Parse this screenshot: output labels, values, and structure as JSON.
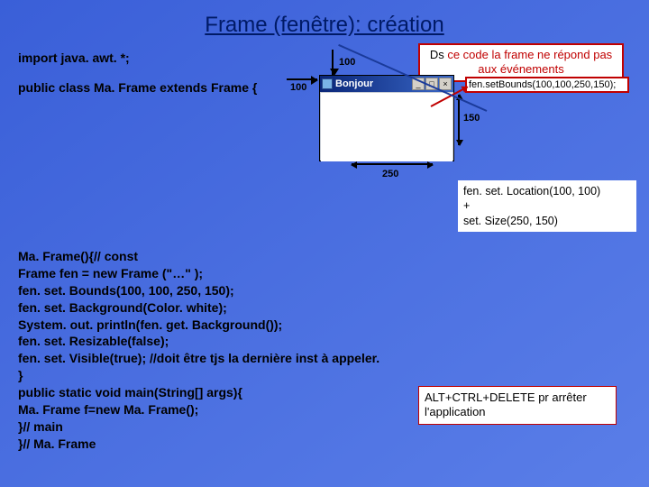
{
  "title": "Frame (fenêtre): création",
  "code_top": {
    "l1": "import java. awt. *;",
    "l2": "public class Ma. Frame extends Frame {"
  },
  "code_bottom": {
    "l1": "Ma. Frame(){// const",
    "l2": "Frame fen = new Frame (\"…\" );",
    "l3": "fen. set. Bounds(100, 100, 250, 150);",
    "l4": "fen. set. Background(Color. white);",
    "l5": "System. out. println(fen. get. Background());",
    "l6": "fen. set. Resizable(false);",
    "l7": "fen. set. Visible(true); //doit être  tjs la dernière inst à appeler.",
    "l8": "}",
    "l9": "public static void main(String[] args){",
    "l10": "Ma. Frame f=new Ma. Frame();",
    "l11": "}// main",
    "l12": "}// Ma. Frame"
  },
  "note_top": {
    "part1": "Ds",
    "part2": " ce code la frame ne répond pas aux événements"
  },
  "equiv": {
    "l1": " fen. set. Location(100, 100)",
    "l2": "+",
    "l3": " set. Size(250, 150)"
  },
  "alt": "ALT+CTRL+DELETE pr arrêter l'application",
  "fig": {
    "v100": "100",
    "h100": "100",
    "w250": "250",
    "h150": "150",
    "win_title": "Bonjour",
    "setbounds": "fen.setBounds(100,100,250,150);",
    "btn_min": "_",
    "btn_max": "□",
    "btn_close": "×"
  }
}
